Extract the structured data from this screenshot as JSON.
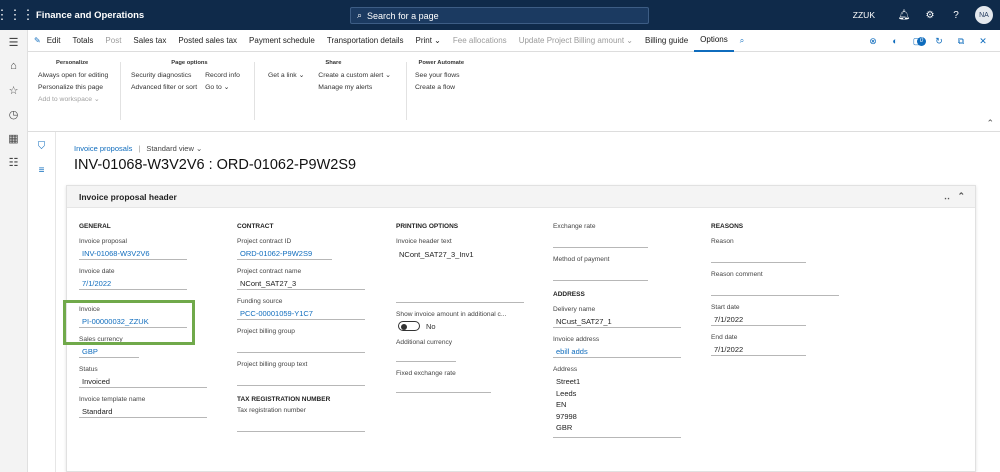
{
  "topbar": {
    "app_name": "Finance and Operations",
    "search_placeholder": "Search for a page",
    "company": "ZZUK",
    "avatar": "NA"
  },
  "commands": [
    {
      "label": "Edit",
      "disabled": false
    },
    {
      "label": "Totals",
      "disabled": false
    },
    {
      "label": "Post",
      "disabled": true
    },
    {
      "label": "Sales tax",
      "disabled": false
    },
    {
      "label": "Posted sales tax",
      "disabled": false
    },
    {
      "label": "Payment schedule",
      "disabled": false
    },
    {
      "label": "Transportation details",
      "disabled": false
    },
    {
      "label": "Print ⌄",
      "disabled": false
    },
    {
      "label": "Fee allocations",
      "disabled": true
    },
    {
      "label": "Update Project Billing amount ⌄",
      "disabled": true
    },
    {
      "label": "Billing guide",
      "disabled": false
    },
    {
      "label": "Options",
      "disabled": false,
      "active": true
    }
  ],
  "notification_count": "0",
  "ribbon": {
    "personalize": {
      "title": "Personalize",
      "items": [
        "Always open for editing",
        "Personalize this page",
        "Add to workspace ⌄"
      ]
    },
    "page_options": {
      "title": "Page options",
      "col1": [
        "Security diagnostics",
        "Advanced filter or sort"
      ],
      "col2": [
        "Record info",
        "Go to ⌄"
      ]
    },
    "share": {
      "title": "Share",
      "col1": [
        "Get a link ⌄"
      ],
      "col2": [
        "Create a custom alert ⌄",
        "Manage my alerts"
      ]
    },
    "power_automate": {
      "title": "Power Automate",
      "items": [
        "See your flows",
        "Create a flow"
      ]
    }
  },
  "breadcrumb": {
    "link": "Invoice proposals",
    "sep": "|",
    "view": "Standard view ⌄"
  },
  "page_title": "INV-01068-W3V2V6 : ORD-01062-P9W2S9",
  "card_title": "Invoice proposal header",
  "general": {
    "title": "GENERAL",
    "invoice_proposal_label": "Invoice proposal",
    "invoice_proposal": "INV-01068-W3V2V6",
    "invoice_date_label": "Invoice date",
    "invoice_date": "7/1/2022",
    "invoice_label": "Invoice",
    "invoice": "PI-00000032_ZZUK",
    "sales_currency_label": "Sales currency",
    "sales_currency": "GBP",
    "status_label": "Status",
    "status": "Invoiced",
    "template_label": "Invoice template name",
    "template": "Standard"
  },
  "contract": {
    "title": "CONTRACT",
    "id_label": "Project contract ID",
    "id": "ORD-01062-P9W2S9",
    "name_label": "Project contract name",
    "name": "NCont_SAT27_3",
    "funding_label": "Funding source",
    "funding": "PCC-00001059-Y1C7",
    "billing_group_label": "Project billing group",
    "billing_group_text_label": "Project billing group text",
    "tax_title": "TAX REGISTRATION NUMBER",
    "tax_label": "Tax registration number"
  },
  "printing": {
    "title": "PRINTING OPTIONS",
    "header_text_label": "Invoice header text",
    "header_text": "NCont_SAT27_3_Inv1",
    "show_label": "Show invoice amount in additional c...",
    "show_value": "No",
    "additional_currency_label": "Additional currency",
    "fixed_rate_label": "Fixed exchange rate"
  },
  "payment": {
    "exchange_rate_label": "Exchange rate",
    "method_label": "Method of payment",
    "address_title": "ADDRESS",
    "delivery_label": "Delivery name",
    "delivery": "NCust_SAT27_1",
    "inv_address_label": "Invoice address",
    "inv_address": "ebill adds",
    "address_label": "Address",
    "address_lines": [
      "Street1",
      "Leeds",
      "EN",
      "97998",
      "GBR"
    ]
  },
  "reasons": {
    "title": "REASONS",
    "reason_label": "Reason",
    "comment_label": "Reason comment",
    "start_label": "Start date",
    "start": "7/1/2022",
    "end_label": "End date",
    "end": "7/1/2022"
  }
}
